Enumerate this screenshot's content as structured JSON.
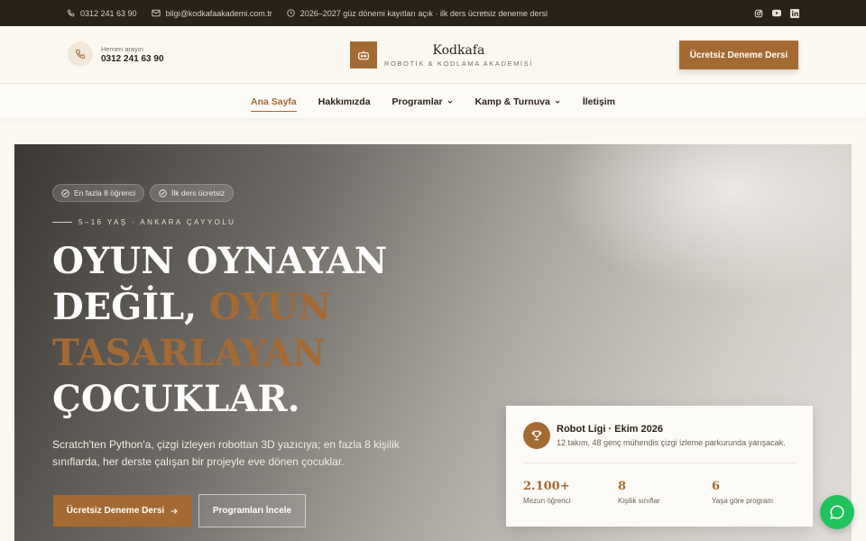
{
  "topbar": {
    "phone": "0312 241 63 90",
    "email": "bilgi@kodkafaakademi.com.tr",
    "notice": "2026–2027 güz dönemi kayıtları açık · ilk ders ücretsiz deneme dersi",
    "socials": [
      "instagram-icon",
      "youtube-icon",
      "linkedin-icon"
    ]
  },
  "header": {
    "call_label": "Hemen arayın",
    "call_number": "0312 241 63 90",
    "brand_name": "Kodkafa",
    "brand_tagline": "ROBOTİK & KODLAMA AKADEMİSİ",
    "cta_label": "Ücretsiz Deneme Dersi"
  },
  "nav": {
    "items": [
      {
        "label": "Ana Sayfa",
        "active": true
      },
      {
        "label": "Hakkımızda"
      },
      {
        "label": "Programlar",
        "dropdown": true
      },
      {
        "label": "Kamp & Turnuva",
        "dropdown": true
      },
      {
        "label": "İletişim"
      }
    ]
  },
  "hero": {
    "badges": [
      "En fazla 8 öğrenci",
      "İlk ders ücretsiz"
    ],
    "eyebrow": "5–16 YAŞ · ANKARA ÇAYYOLU",
    "headline_1": "OYUN OYNAYAN DEĞİL,",
    "headline_accent": "OYUN TASARLAYAN",
    "headline_2": "ÇOCUKLAR.",
    "lead": "Scratch'ten Python'a, çizgi izleyen robottan 3D yazıcıya; en fazla 8 kişilik sınıflarda, her derste çalışan bir projeyle eve dönen çocuklar.",
    "primary_button": "Ücretsiz Deneme Dersi",
    "secondary_button": "Programları İncele"
  },
  "card": {
    "title": "Robot Ligi · Ekim 2026",
    "subtitle": "12 takım, 48 genç mühendis çizgi izleme parkurunda yarışacak.",
    "stats": [
      {
        "value": "2.100+",
        "label": "Mezun öğrenci"
      },
      {
        "value": "8",
        "label": "Kişilik sınıflar"
      },
      {
        "value": "6",
        "label": "Yaşa göre program"
      }
    ]
  },
  "colors": {
    "accent": "#a46a34",
    "dark": "#2a2118",
    "whatsapp": "#22c35e"
  }
}
